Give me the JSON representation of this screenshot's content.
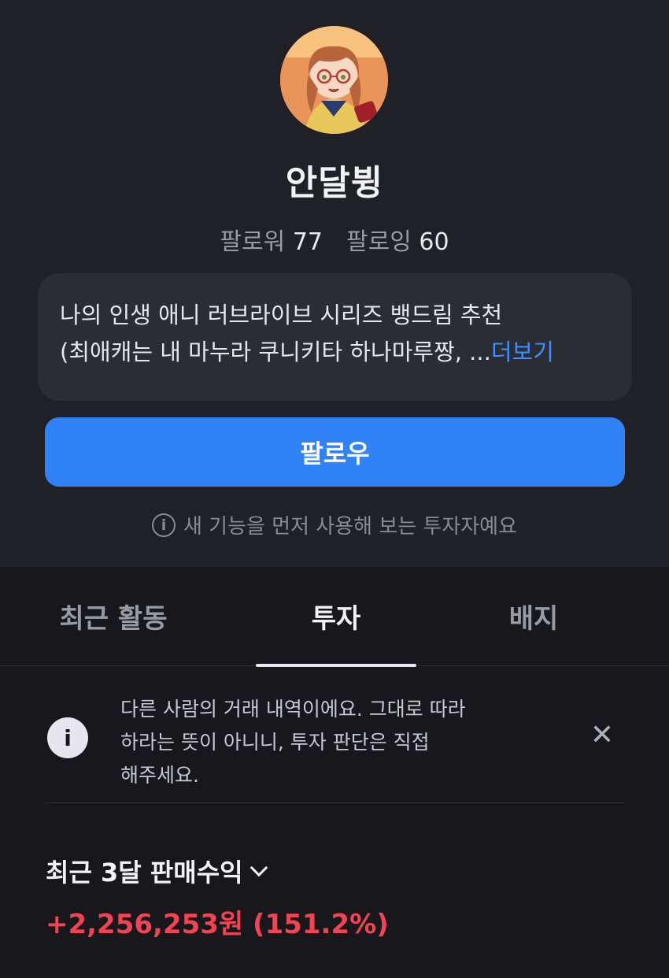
{
  "profile": {
    "name": "안달뷩",
    "followers_label": "팔로워",
    "followers_count": "77",
    "following_label": "팔로잉",
    "following_count": "60",
    "bio_line1": "나의 인생 애니 러브라이브 시리즈 뱅드림 추천",
    "bio_line2": "(최애캐는 내 마누라 쿠니키타 하나마루짱,  ...",
    "bio_more": "더보기",
    "follow_button": "팔로우",
    "beta_icon": "info-icon",
    "beta_note": "새 기능을 먼저 사용해 보는 투자자예요"
  },
  "tabs": [
    {
      "label": "최근 활동",
      "active": false
    },
    {
      "label": "투자",
      "active": true
    },
    {
      "label": "배지",
      "active": false
    }
  ],
  "notice": {
    "icon": "info-icon",
    "line1": "다른 사람의 거래 내역이에요. 그대로 따라",
    "line2": "하라는 뜻이 아니니, 투자 판단은 직접",
    "line3": "해주세요.",
    "close_icon": "close-icon"
  },
  "profit": {
    "title": "최근 3달 판매수익",
    "value": "+2,256,253원 (151.2%)",
    "color": "#f04452"
  },
  "colors": {
    "accent": "#3182f6",
    "link": "#3d8fff",
    "background": "#17171c",
    "header_background": "#202027"
  }
}
